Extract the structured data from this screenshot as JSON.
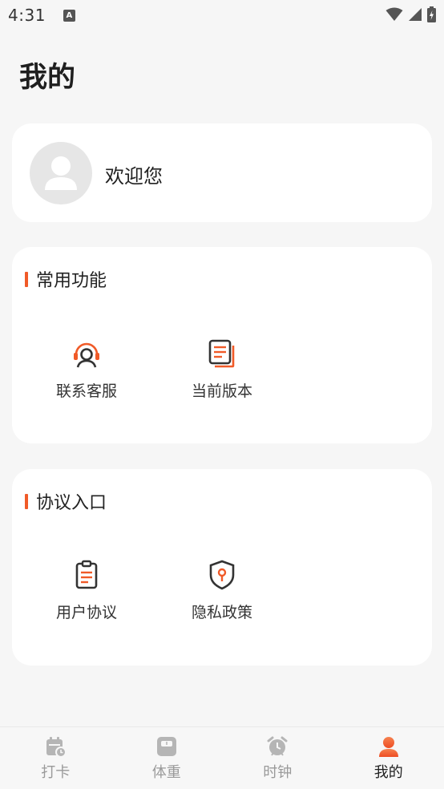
{
  "status_bar": {
    "time": "4:31",
    "a_icon_text": "A"
  },
  "page": {
    "title": "我的"
  },
  "profile": {
    "welcome_text": "欢迎您"
  },
  "sections": [
    {
      "title": "常用功能",
      "items": [
        {
          "label": "联系客服",
          "icon": "headset-icon"
        },
        {
          "label": "当前版本",
          "icon": "document-stack-icon"
        }
      ]
    },
    {
      "title": "协议入口",
      "items": [
        {
          "label": "用户协议",
          "icon": "clipboard-icon"
        },
        {
          "label": "隐私政策",
          "icon": "shield-icon"
        }
      ]
    }
  ],
  "bottom_nav": {
    "items": [
      {
        "label": "打卡",
        "icon": "calendar-check-icon",
        "active": false
      },
      {
        "label": "体重",
        "icon": "scale-icon",
        "active": false
      },
      {
        "label": "时钟",
        "icon": "alarm-clock-icon",
        "active": false
      },
      {
        "label": "我的",
        "icon": "person-icon",
        "active": true
      }
    ]
  },
  "colors": {
    "accent": "#f05a28",
    "icon_dark": "#333333",
    "nav_inactive": "#b5b5b5",
    "background": "#f6f6f6",
    "card": "#ffffff"
  }
}
